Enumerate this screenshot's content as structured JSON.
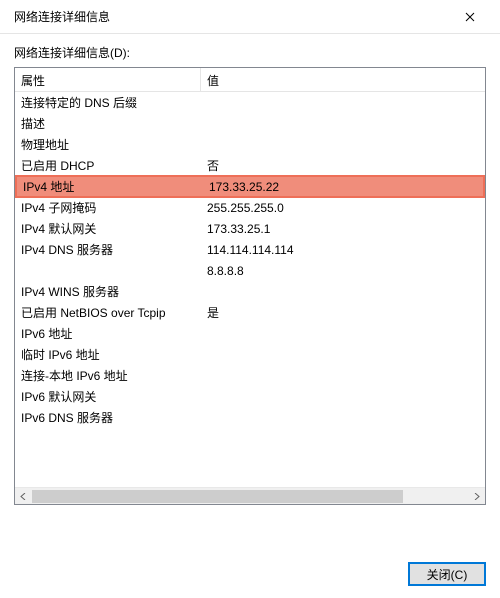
{
  "window": {
    "title": "网络连接详细信息"
  },
  "content": {
    "list_label": "网络连接详细信息(D):",
    "columns": {
      "property": "属性",
      "value": "值"
    },
    "rows": [
      {
        "prop": "连接特定的 DNS 后缀",
        "val": "",
        "highlight": false
      },
      {
        "prop": "描述",
        "val": "",
        "highlight": false
      },
      {
        "prop": "物理地址",
        "val": "",
        "highlight": false
      },
      {
        "prop": "已启用 DHCP",
        "val": "否",
        "highlight": false
      },
      {
        "prop": "IPv4 地址",
        "val": "173.33.25.22",
        "highlight": true
      },
      {
        "prop": "IPv4 子网掩码",
        "val": "255.255.255.0",
        "highlight": false
      },
      {
        "prop": "IPv4 默认网关",
        "val": "173.33.25.1",
        "highlight": false
      },
      {
        "prop": "IPv4 DNS 服务器",
        "val": "114.114.114.114",
        "highlight": false
      },
      {
        "prop": "",
        "val": "8.8.8.8",
        "highlight": false
      },
      {
        "prop": "IPv4 WINS 服务器",
        "val": "",
        "highlight": false
      },
      {
        "prop": "已启用 NetBIOS over Tcpip",
        "val": "是",
        "highlight": false
      },
      {
        "prop": "IPv6 地址",
        "val": "",
        "highlight": false
      },
      {
        "prop": "临时 IPv6 地址",
        "val": "",
        "highlight": false
      },
      {
        "prop": "连接-本地 IPv6 地址",
        "val": "",
        "highlight": false
      },
      {
        "prop": "IPv6 默认网关",
        "val": "",
        "highlight": false
      },
      {
        "prop": "IPv6 DNS 服务器",
        "val": "",
        "highlight": false
      }
    ]
  },
  "footer": {
    "close_label": "关闭(C)"
  }
}
